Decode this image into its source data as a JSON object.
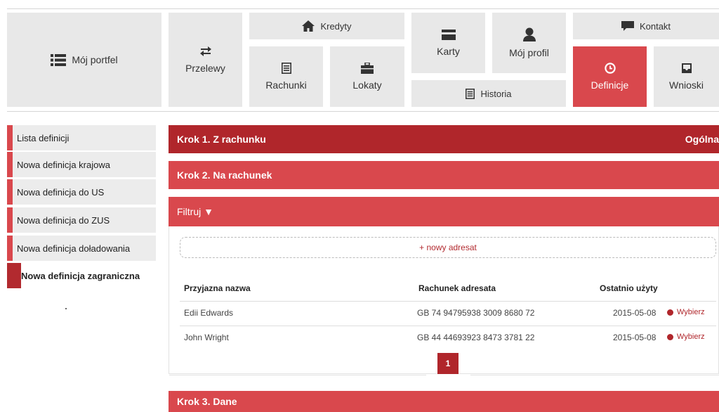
{
  "nav": {
    "portfolio": "Mój portfel",
    "transfers": "Przelewy",
    "credits": "Kredyty",
    "accounts": "Rachunki",
    "deposits": "Lokaty",
    "cards": "Karty",
    "profile": "Mój profil",
    "history": "Historia",
    "contact": "Kontakt",
    "definitions": "Definicje",
    "requests": "Wnioski"
  },
  "sidebar": {
    "items": [
      {
        "label": "Lista definicji"
      },
      {
        "label": "Nowa definicja krajowa"
      },
      {
        "label": "Nowa definicja do US"
      },
      {
        "label": "Nowa definicja do ZUS"
      },
      {
        "label": "Nowa definicja doładowania"
      },
      {
        "label": "Nowa definicja zagraniczna"
      }
    ]
  },
  "steps": {
    "step1": "Krok 1. Z rachunku",
    "step1_right": "Ogólna",
    "step2": "Krok 2. Na rachunek",
    "step3": "Krok 3. Dane"
  },
  "filter": {
    "label": "Filtruj ▼"
  },
  "new_recipient": "+ nowy adresat",
  "table": {
    "headers": [
      "Przyjazna nazwa",
      "Rachunek adresata",
      "Ostatnio użyty"
    ],
    "rows": [
      {
        "name": "Edii Edwards",
        "account": "GB 74 94795938 3009 8680 72",
        "last_used": "2015-05-08",
        "action": "Wybierz"
      },
      {
        "name": "John Wright",
        "account": "GB 44 44693923 8473 3781 22",
        "last_used": "2015-05-08",
        "action": "Wybierz"
      }
    ]
  },
  "pagination": {
    "current": "1"
  },
  "colors": {
    "accent": "#d9484d",
    "accent_dark": "#b0262b",
    "tile": "#e8e8e8"
  }
}
